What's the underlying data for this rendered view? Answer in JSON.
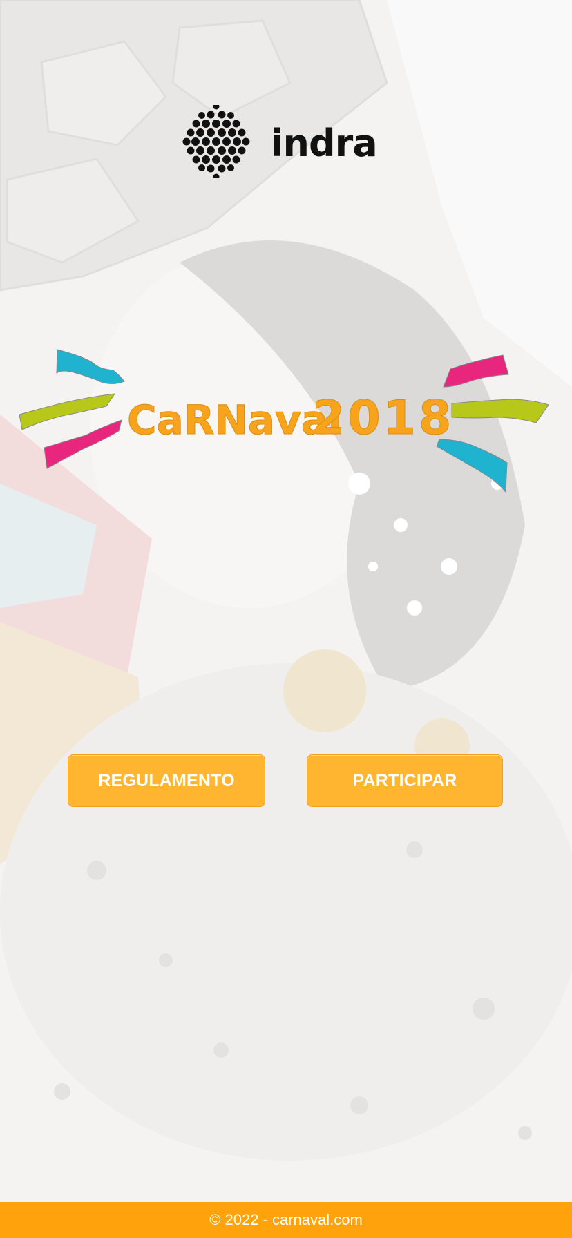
{
  "brand": {
    "logo_text": "indra"
  },
  "hero": {
    "title_word": "CaRNaval",
    "title_year": "2018"
  },
  "actions": {
    "regulamento_label": "REGULAMENTO",
    "participar_label": "PARTICIPAR"
  },
  "footer": {
    "text": "© 2022 - carnaval.com"
  },
  "colors": {
    "accent_orange": "#ffa20b",
    "button_orange": "#ffb52f",
    "streamer_cyan": "#1fb3cf",
    "streamer_lime": "#b7c81b",
    "streamer_magenta": "#e8267d"
  }
}
